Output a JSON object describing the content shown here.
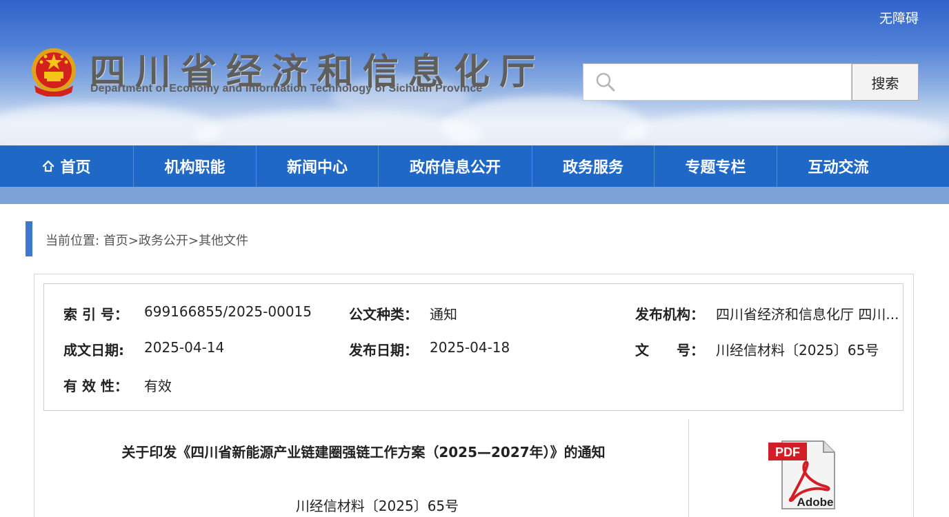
{
  "header": {
    "accessibility_label": "无障碍",
    "title": "四川省经济和信息化厅",
    "subtitle": "Department of Economy and Information Technology of Sichuan Province",
    "search_placeholder": "",
    "search_button": "搜索"
  },
  "nav": {
    "items": [
      {
        "label": "首页",
        "icon": "home-icon"
      },
      {
        "label": "机构职能"
      },
      {
        "label": "新闻中心"
      },
      {
        "label": "政府信息公开"
      },
      {
        "label": "政务服务"
      },
      {
        "label": "专题专栏"
      },
      {
        "label": "互动交流"
      }
    ]
  },
  "breadcrumb": {
    "prefix": "当前位置:",
    "items": [
      "首页",
      "政务公开",
      "其他文件"
    ],
    "separator": ">"
  },
  "meta": {
    "index_label": "索 引 号：",
    "index_value": "699166855/2025-00015",
    "doc_type_label": "公文种类：",
    "doc_type_value": "通知",
    "publisher_label": "发布机构：",
    "publisher_value": "四川省经济和信息化厅 四川...",
    "written_date_label": "成文日期:",
    "written_date_value": "2025-04-14",
    "publish_date_label": "发布日期：",
    "publish_date_value": "2025-04-18",
    "doc_no_label": "文　　号：",
    "doc_no_value": "川经信材料〔2025〕65号",
    "validity_label": "有 效 性：",
    "validity_value": "有效"
  },
  "document": {
    "title": "关于印发《四川省新能源产业链建圈强链工作方案（2025—2027年）》的通知",
    "number": "川经信材料〔2025〕65号"
  },
  "attachment": {
    "badge": "PDF",
    "brand": "Adobe",
    "icon": "pdf-file-icon"
  },
  "colors": {
    "nav_bg": "#2068c5",
    "accent_bar": "#3a79cf",
    "pdf_red": "#d21f26"
  }
}
